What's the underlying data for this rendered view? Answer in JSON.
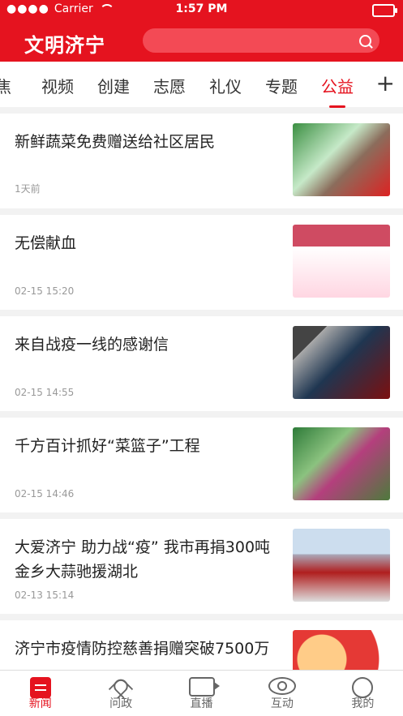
{
  "status_bar": {
    "carrier": "Carrier",
    "time": "1:57 PM"
  },
  "header": {
    "title": "文明济宁"
  },
  "tabs": [
    "焦",
    "视频",
    "创建",
    "志愿",
    "礼仪",
    "专题",
    "公益"
  ],
  "active_tab": "公益",
  "tab_plus": "+",
  "feed": [
    {
      "title": "新鲜蔬菜免费赠送给社区居民",
      "time": "1天前",
      "image": "veg"
    },
    {
      "title": "无偿献血",
      "time": "02-15 15:20",
      "image": "blood"
    },
    {
      "title": "来自战疫一线的感谢信",
      "time": "02-15 14:55",
      "image": "fight"
    },
    {
      "title": "千方百计抓好“菜篮子”工程",
      "time": "02-15 14:46",
      "image": "basket"
    },
    {
      "title": "大爱济宁 助力战“疫” 我市再捐300吨金乡大蒜驰援湖北",
      "time": "02-13 15:14",
      "image": "trucks"
    },
    {
      "title": "济宁市疫情防控慈善捐赠突破7500万",
      "time": "",
      "image": "charity"
    }
  ],
  "bottom_nav": [
    {
      "label": "新闻",
      "icon": "news-icon",
      "active": true
    },
    {
      "label": "问政",
      "icon": "heart-icon",
      "active": false
    },
    {
      "label": "直播",
      "icon": "camera-icon",
      "active": false
    },
    {
      "label": "互动",
      "icon": "eye-icon",
      "active": false
    },
    {
      "label": "我的",
      "icon": "user-icon",
      "active": false
    }
  ]
}
